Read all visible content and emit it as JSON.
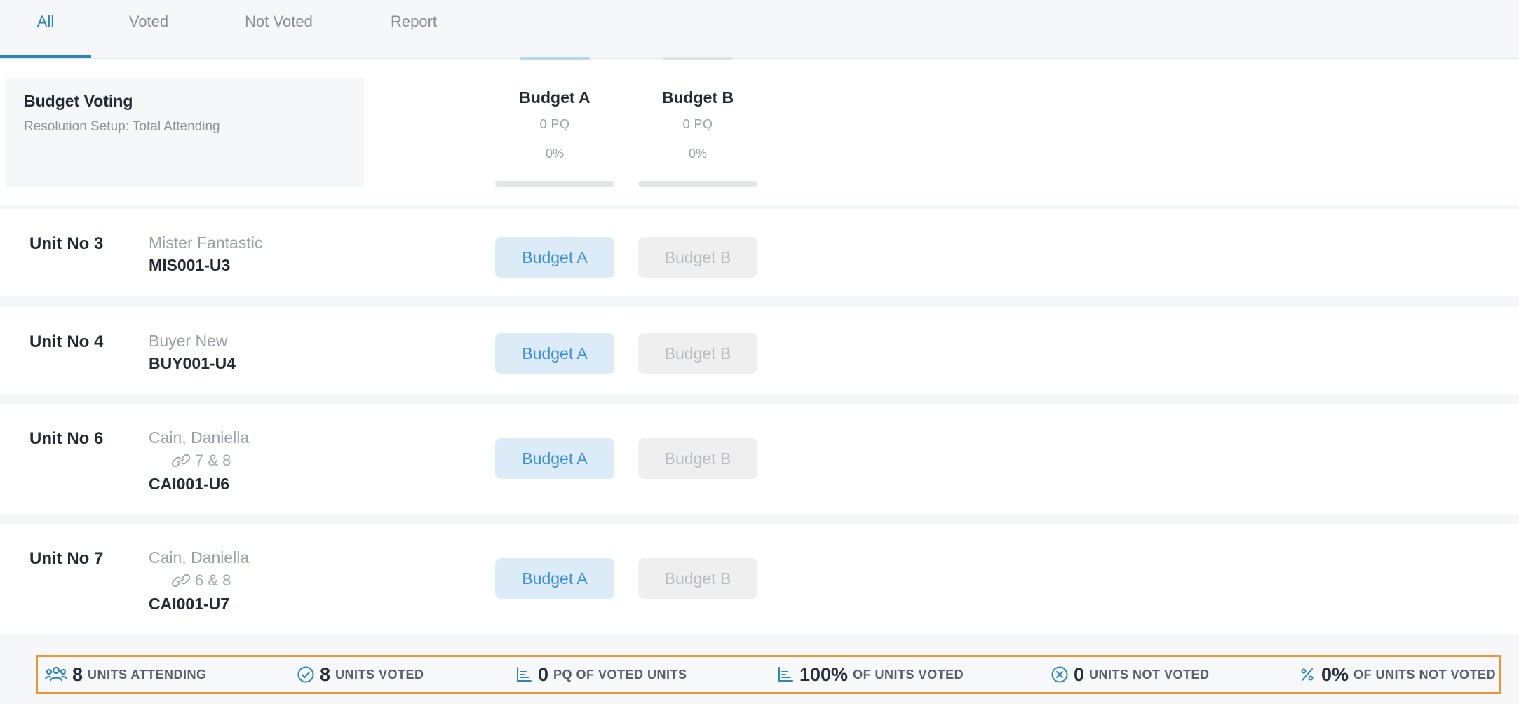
{
  "tabs": [
    {
      "label": "All",
      "active": true
    },
    {
      "label": "Voted",
      "active": false
    },
    {
      "label": "Not Voted",
      "active": false
    },
    {
      "label": "Report",
      "active": false
    }
  ],
  "resolution": {
    "title": "Budget Voting",
    "subtitle": "Resolution Setup: Total Attending",
    "options": [
      {
        "name": "Budget A",
        "pq": "0 PQ",
        "percent": "0%",
        "fill": 0
      },
      {
        "name": "Budget B",
        "pq": "0 PQ",
        "percent": "0%",
        "fill": 0
      }
    ]
  },
  "units": [
    {
      "label": "Unit No 3",
      "owner": "Mister Fantastic",
      "linked": "",
      "code": "MIS001-U3",
      "buttons": [
        "Budget A",
        "Budget B"
      ],
      "selected": 0
    },
    {
      "label": "Unit No 4",
      "owner": "Buyer New",
      "linked": "",
      "code": "BUY001-U4",
      "buttons": [
        "Budget A",
        "Budget B"
      ],
      "selected": 0
    },
    {
      "label": "Unit No 6",
      "owner": "Cain, Daniella",
      "linked": "7 & 8",
      "code": "CAI001-U6",
      "buttons": [
        "Budget A",
        "Budget B"
      ],
      "selected": 0
    },
    {
      "label": "Unit No 7",
      "owner": "Cain, Daniella",
      "linked": "6 & 8",
      "code": "CAI001-U7",
      "buttons": [
        "Budget A",
        "Budget B"
      ],
      "selected": 0
    }
  ],
  "footer": [
    {
      "icon": "users-icon",
      "value": "8",
      "label": "UNITS ATTENDING"
    },
    {
      "icon": "check-circle-icon",
      "value": "8",
      "label": "UNITS VOTED"
    },
    {
      "icon": "chart-icon",
      "value": "0",
      "label": "PQ OF VOTED UNITS"
    },
    {
      "icon": "chart-icon",
      "value": "100%",
      "label": "OF UNITS VOTED"
    },
    {
      "icon": "x-circle-icon",
      "value": "0",
      "label": "UNITS NOT VOTED"
    },
    {
      "icon": "percent-icon",
      "value": "0%",
      "label": "OF UNITS NOT VOTED"
    }
  ],
  "colors": {
    "accent": "#2b86b8",
    "selected_bg": "#dcebf8",
    "selected_text": "#3c8fd6",
    "footer_border": "#ef9533"
  }
}
